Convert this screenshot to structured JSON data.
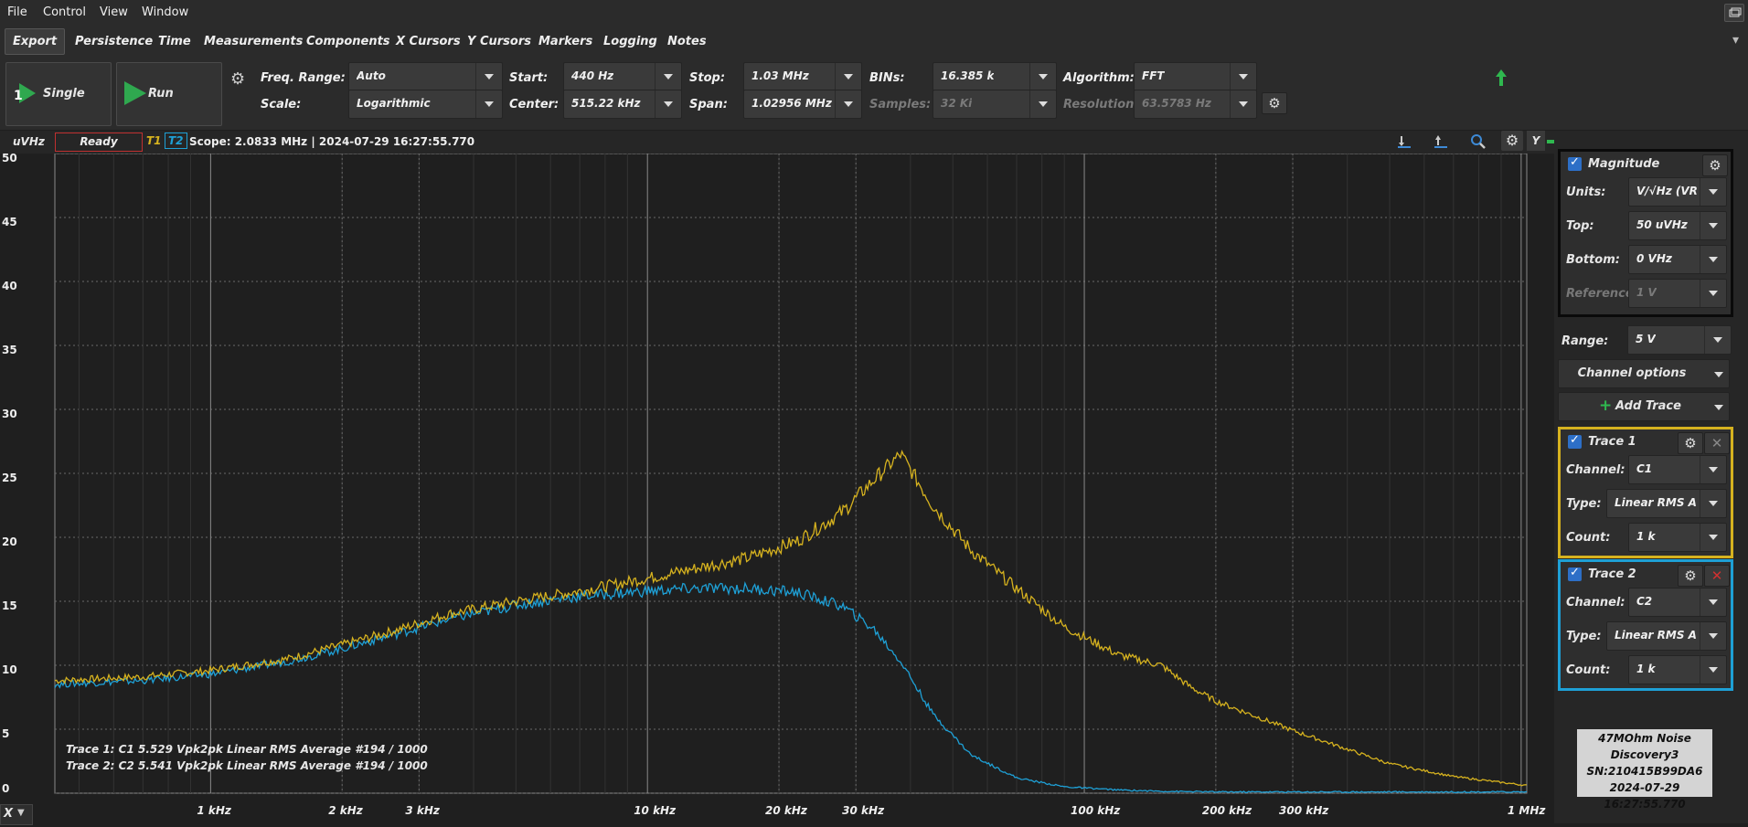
{
  "menu": [
    "File",
    "Control",
    "View",
    "Window"
  ],
  "tabs": [
    "Export",
    "Persistence",
    "Time",
    "Measurements",
    "Components",
    "X Cursors",
    "Y Cursors",
    "Markers",
    "Logging",
    "Notes"
  ],
  "controls": {
    "single_label": "Single",
    "run_label": "Run",
    "freq_range": {
      "label": "Freq. Range:",
      "value": "Auto"
    },
    "scale": {
      "label": "Scale:",
      "value": "Logarithmic"
    },
    "start": {
      "label": "Start:",
      "value": "440 Hz"
    },
    "center": {
      "label": "Center:",
      "value": "515.22 kHz"
    },
    "stop": {
      "label": "Stop:",
      "value": "1.03 MHz"
    },
    "span": {
      "label": "Span:",
      "value": "1.02956 MHz"
    },
    "bins": {
      "label": "BINs:",
      "value": "16.385 k"
    },
    "samples": {
      "label": "Samples:",
      "value": "32 Ki"
    },
    "algorithm": {
      "label": "Algorithm:",
      "value": "FFT"
    },
    "resolution": {
      "label": "Resolution:",
      "value": "63.5783 Hz"
    }
  },
  "status": {
    "unit": "uVHz",
    "state": "Ready",
    "t1": "T1",
    "t2": "T2",
    "scope_text": "Scope: 2.0833 MHz | 2024-07-29 16:27:55.770",
    "y_label": "Y"
  },
  "side": {
    "magnitude": {
      "title": "Magnitude",
      "units": {
        "label": "Units:",
        "value": "V/√Hz (VR"
      },
      "top": {
        "label": "Top:",
        "value": "50 uVHz"
      },
      "bottom": {
        "label": "Bottom:",
        "value": "0 VHz"
      },
      "reference": {
        "label": "Reference:",
        "value": "1 V"
      }
    },
    "range": {
      "label": "Range:",
      "value": "5 V"
    },
    "channel_options": "Channel options",
    "add_trace": "Add Trace",
    "trace1": {
      "title": "Trace 1",
      "channel": {
        "label": "Channel:",
        "value": "C1"
      },
      "type": {
        "label": "Type:",
        "value": "Linear RMS A"
      },
      "count": {
        "label": "Count:",
        "value": "1 k"
      }
    },
    "trace2": {
      "title": "Trace 2",
      "channel": {
        "label": "Channel:",
        "value": "C2"
      },
      "type": {
        "label": "Type:",
        "value": "Linear RMS A"
      },
      "count": {
        "label": "Count:",
        "value": "1 k"
      }
    },
    "info": [
      "47MOhm Noise",
      "Discovery3",
      "SN:210415B99DA6",
      "2024-07-29 16:27:55.770"
    ]
  },
  "colors": {
    "trace1": "#d6b21f",
    "trace2": "#1ea0d6",
    "ready_border": "#c03030"
  },
  "chart_data": {
    "type": "line",
    "xscale": "log",
    "xlim": [
      440,
      1030000
    ],
    "ylim": [
      0,
      50
    ],
    "yticks": [
      0,
      5,
      10,
      15,
      20,
      25,
      30,
      35,
      40,
      45,
      50
    ],
    "xticks": [
      {
        "v": 1000,
        "label": "1 kHz"
      },
      {
        "v": 2000,
        "label": "2 kHz"
      },
      {
        "v": 3000,
        "label": "3 kHz"
      },
      {
        "v": 10000,
        "label": "10 kHz"
      },
      {
        "v": 20000,
        "label": "20 kHz"
      },
      {
        "v": 30000,
        "label": "30 kHz"
      },
      {
        "v": 100000,
        "label": "100 kHz"
      },
      {
        "v": 200000,
        "label": "200 kHz"
      },
      {
        "v": 300000,
        "label": "300 kHz"
      },
      {
        "v": 1000000,
        "label": "1 MHz"
      }
    ],
    "x_axis_label": "X",
    "grid": true,
    "annotations": [
      "Trace 1: C1 5.529 Vpk2pk Linear RMS Average #194 / 1000",
      "Trace 2: C2 5.541 Vpk2pk Linear RMS Average #194 / 1000"
    ],
    "series": [
      {
        "name": "Trace 1",
        "x": [
          440,
          700,
          1000,
          1500,
          2000,
          2700,
          3500,
          5000,
          7000,
          10000,
          13000,
          17000,
          22000,
          28000,
          33000,
          38000,
          45000,
          55000,
          70000,
          90000,
          120000,
          150000,
          175000,
          200000,
          300000,
          500000,
          700000,
          1030000
        ],
        "y": [
          8.8,
          9.1,
          9.6,
          10.5,
          11.6,
          12.8,
          14.0,
          15.0,
          15.8,
          16.8,
          17.6,
          18.4,
          19.7,
          22.0,
          24.5,
          26.5,
          22.5,
          19.0,
          16.0,
          13.0,
          10.8,
          10.0,
          8.3,
          7.2,
          4.9,
          2.3,
          1.3,
          0.6
        ]
      },
      {
        "name": "Trace 2",
        "x": [
          440,
          700,
          1000,
          1500,
          2000,
          2700,
          3500,
          5000,
          7000,
          10000,
          13000,
          17000,
          22000,
          28000,
          33000,
          38000,
          45000,
          55000,
          70000,
          90000,
          120000,
          150000,
          200000,
          300000,
          500000,
          1030000
        ],
        "y": [
          8.5,
          8.8,
          9.3,
          10.3,
          11.3,
          12.5,
          13.6,
          14.7,
          15.4,
          15.8,
          16.0,
          16.0,
          15.7,
          14.6,
          12.8,
          10.3,
          6.2,
          3.0,
          1.2,
          0.5,
          0.25,
          0.15,
          0.1,
          0.1,
          0.1,
          0.1
        ]
      }
    ]
  }
}
